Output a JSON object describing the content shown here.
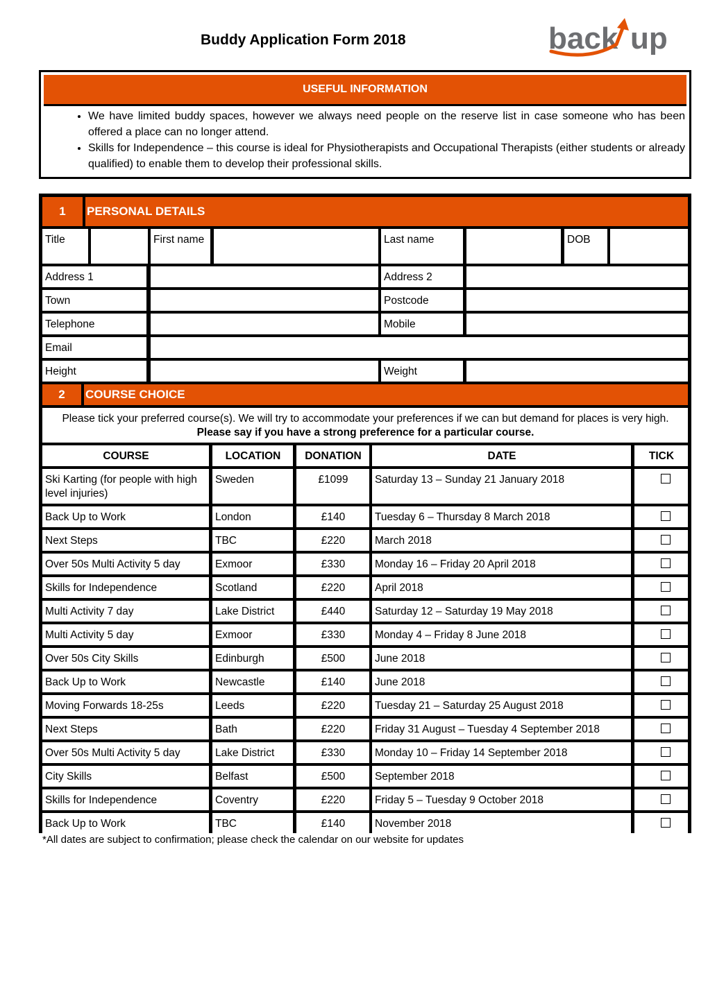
{
  "header": {
    "title": "Buddy Application Form 2018",
    "logo": {
      "text_left": "back",
      "text_right": "up",
      "icon": "arrow-up-swoosh",
      "brand_color": "#e35205",
      "text_color": "#6d6e71"
    }
  },
  "useful_information": {
    "heading": "USEFUL INFORMATION",
    "bullets": [
      "We have limited buddy spaces, however we always need people on the reserve list in case someone who has been offered a place can no longer attend.",
      "Skills for Independence – this course is ideal for Physiotherapists and Occupational Therapists (either students or already qualified) to enable them to develop their professional skills."
    ]
  },
  "personal_details": {
    "number": "1",
    "heading": "PERSONAL DETAILS",
    "fields": {
      "title": {
        "label": "Title",
        "value": ""
      },
      "first_name": {
        "label": "First name",
        "value": ""
      },
      "last_name": {
        "label": "Last name",
        "value": ""
      },
      "dob": {
        "label": "DOB",
        "value": ""
      },
      "address1": {
        "label": "Address 1",
        "value": ""
      },
      "address2": {
        "label": "Address 2",
        "value": ""
      },
      "town": {
        "label": "Town",
        "value": ""
      },
      "postcode": {
        "label": "Postcode",
        "value": ""
      },
      "telephone": {
        "label": "Telephone",
        "value": ""
      },
      "mobile": {
        "label": "Mobile",
        "value": ""
      },
      "email": {
        "label": "Email",
        "value": ""
      },
      "height": {
        "label": "Height",
        "value": ""
      },
      "weight": {
        "label": "Weight",
        "value": ""
      }
    }
  },
  "course_choice": {
    "number": "2",
    "heading": "COURSE CHOICE",
    "intro": "Please tick your preferred course(s).  We will try to accommodate your preferences if we can but demand for places is very high. ",
    "intro_bold": "Please say if you have a strong preference for a particular course.",
    "columns": [
      "COURSE",
      "LOCATION",
      "DONATION",
      "DATE",
      "TICK"
    ],
    "rows": [
      {
        "course": "Ski Karting (for people with high level injuries)",
        "location": "Sweden",
        "donation": "£1099",
        "date": "Saturday 13 – Sunday 21 January 2018",
        "ticked": false
      },
      {
        "course": "Back Up to Work",
        "location": "London",
        "donation": "£140",
        "date": "Tuesday 6 – Thursday 8 March 2018",
        "ticked": false
      },
      {
        "course": "Next Steps",
        "location": "TBC",
        "donation": "£220",
        "date": "March 2018",
        "ticked": false
      },
      {
        "course": "Over 50s Multi Activity 5 day",
        "location": "Exmoor",
        "donation": "£330",
        "date": "Monday 16 – Friday 20 April 2018",
        "ticked": false
      },
      {
        "course": "Skills for Independence",
        "location": "Scotland",
        "donation": "£220",
        "date": "April 2018",
        "ticked": false
      },
      {
        "course": "Multi Activity 7 day",
        "location": "Lake District",
        "donation": "£440",
        "date": "Saturday 12 – Saturday 19 May 2018",
        "ticked": false
      },
      {
        "course": "Multi Activity 5 day",
        "location": "Exmoor",
        "donation": "£330",
        "date": "Monday 4 – Friday 8 June 2018",
        "ticked": false
      },
      {
        "course": "Over 50s City Skills",
        "location": "Edinburgh",
        "donation": "£500",
        "date": "June 2018",
        "ticked": false
      },
      {
        "course": "Back Up to Work",
        "location": "Newcastle",
        "donation": "£140",
        "date": "June 2018",
        "ticked": false
      },
      {
        "course": "Moving Forwards 18-25s",
        "location": "Leeds",
        "donation": "£220",
        "date": "Tuesday 21 – Saturday 25 August 2018",
        "ticked": false
      },
      {
        "course": "Next Steps",
        "location": "Bath",
        "donation": "£220",
        "date": "Friday 31 August – Tuesday 4 September 2018",
        "ticked": false
      },
      {
        "course": "Over 50s Multi Activity 5 day",
        "location": "Lake District",
        "donation": "£330",
        "date": "Monday 10 – Friday 14 September 2018",
        "ticked": false
      },
      {
        "course": "City Skills",
        "location": "Belfast",
        "donation": "£500",
        "date": "September 2018",
        "ticked": false
      },
      {
        "course": "Skills for Independence",
        "location": "Coventry",
        "donation": "£220",
        "date": "Friday 5 – Tuesday 9 October 2018",
        "ticked": false
      },
      {
        "course": "Back Up to Work",
        "location": "TBC",
        "donation": "£140",
        "date": "November 2018",
        "ticked": false
      }
    ],
    "footnote": "*All dates are subject to confirmation; please check the calendar on our website for updates"
  }
}
